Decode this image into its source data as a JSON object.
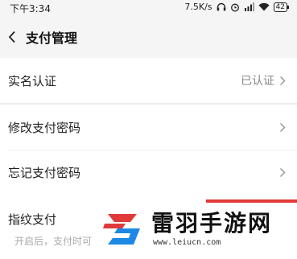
{
  "status_bar": {
    "time": "下午3:34",
    "net_speed": "7.5K/s",
    "battery": "42"
  },
  "nav": {
    "title": "支付管理"
  },
  "rows": {
    "real_name": {
      "label": "实名认证",
      "value": "已认证"
    },
    "change_password": {
      "label": "修改支付密码"
    },
    "forgot_password": {
      "label": "忘记支付密码"
    },
    "fingerprint": {
      "label": "指纹支付",
      "description": "开启后，支付时可"
    }
  },
  "watermark": {
    "title": "雷羽手游网",
    "url": "www.leiucn.com"
  },
  "colors": {
    "accent_red": "#e03a3a",
    "logo_blue": "#1e88e5"
  }
}
